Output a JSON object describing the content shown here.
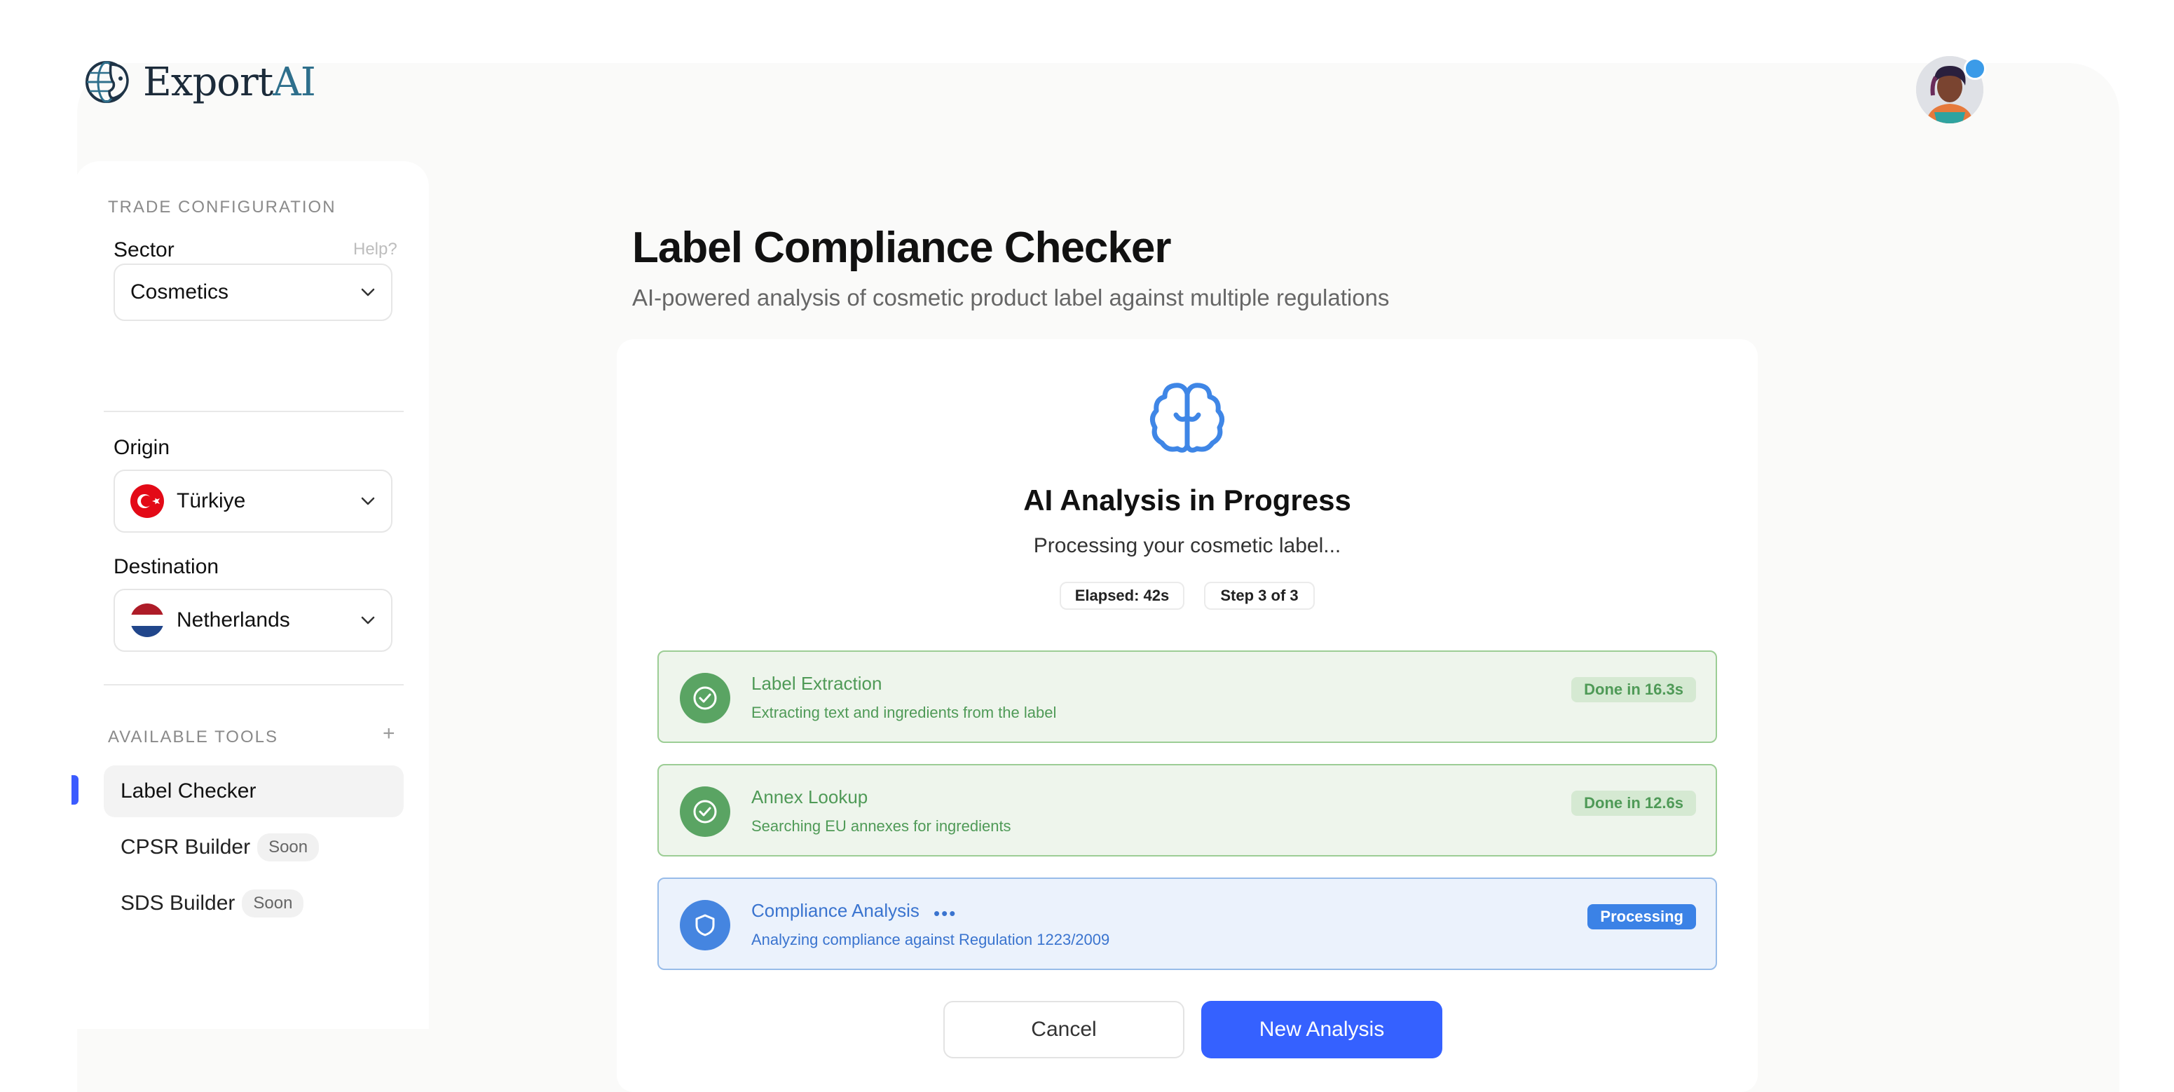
{
  "brand": {
    "name_main": "Export",
    "name_accent": "AI"
  },
  "sidebar": {
    "trade_config_label": "TRADE CONFIGURATION",
    "sector": {
      "label": "Sector",
      "help": "Help?",
      "value": "Cosmetics"
    },
    "origin": {
      "label": "Origin",
      "value": "Türkiye"
    },
    "destination": {
      "label": "Destination",
      "value": "Netherlands"
    },
    "tools_label": "AVAILABLE TOOLS",
    "add_symbol": "+",
    "tools": [
      {
        "label": "Label Checker",
        "badge": "",
        "active": true
      },
      {
        "label": "CPSR Builder",
        "badge": "Soon",
        "active": false
      },
      {
        "label": "SDS Builder",
        "badge": "Soon",
        "active": false
      }
    ]
  },
  "main": {
    "title": "Label Compliance Checker",
    "subtitle": "AI-powered analysis of cosmetic product label against multiple regulations",
    "progress": {
      "title": "AI Analysis in Progress",
      "subtitle": "Processing your cosmetic label...",
      "elapsed": "Elapsed: 42s",
      "step": "Step 3 of 3",
      "steps": [
        {
          "title": "Label Extraction",
          "desc": "Extracting text and ingredients from the label",
          "badge": "Done in 16.3s",
          "status": "done"
        },
        {
          "title": "Annex Lookup",
          "desc": "Searching EU annexes for ingredients",
          "badge": "Done in 12.6s",
          "status": "done"
        },
        {
          "title": "Compliance Analysis",
          "desc": "Analyzing compliance against Regulation 1223/2009",
          "badge": "Processing",
          "status": "processing",
          "dots": "•••"
        }
      ]
    },
    "actions": {
      "cancel": "Cancel",
      "new_analysis": "New Analysis"
    }
  },
  "colors": {
    "accent": "#3561ff",
    "done_green": "#5aa463",
    "processing_blue": "#3b82e6",
    "brain_icon": "#3f86e6"
  },
  "icons": {
    "logo": "globe-brain-icon",
    "chevron": "chevron-down-icon",
    "step_done": "check-circle-icon",
    "step_processing": "shield-icon",
    "analysis": "brain-icon"
  }
}
